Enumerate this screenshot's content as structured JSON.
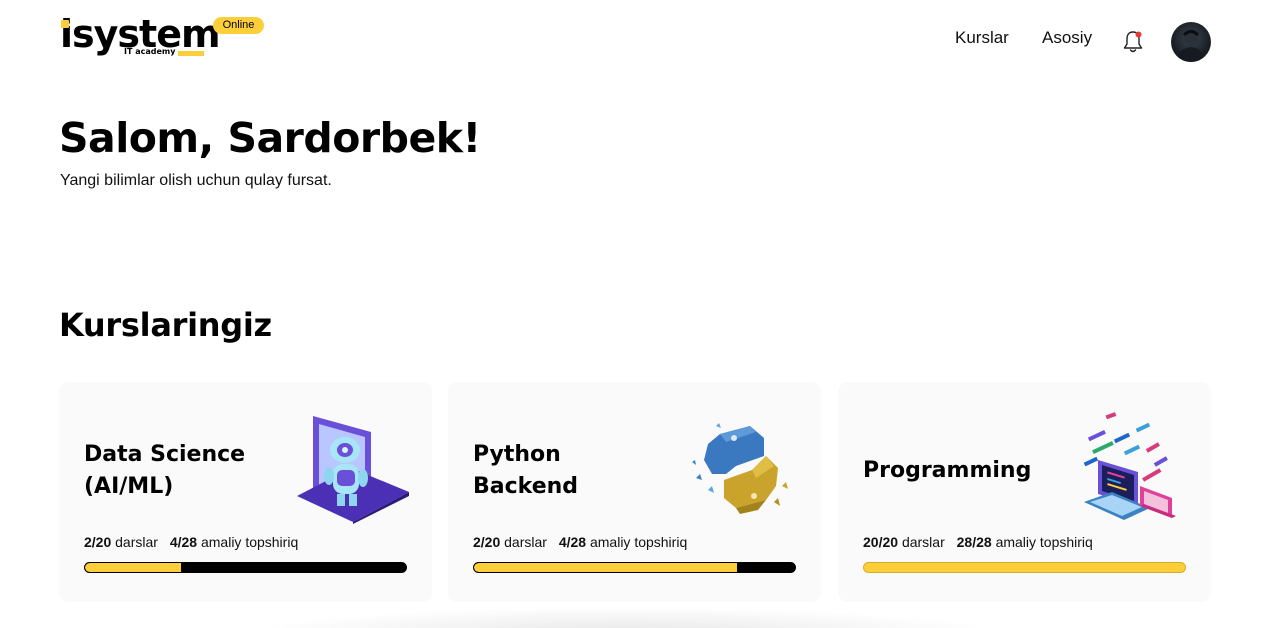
{
  "header": {
    "logo_text": "isystem",
    "logo_subtitle": "IT academy",
    "badge": "Online",
    "nav": [
      "Kurslar",
      "Asosiy"
    ],
    "icons": [
      "bell-icon",
      "avatar"
    ],
    "notification_dot_color": "#e53935"
  },
  "greeting": {
    "title": "Salom, Sardorbek!",
    "subtitle": "Yangi bilimlar olish uchun qulay fursat."
  },
  "courses_section": {
    "title": "Kurslaringiz",
    "courses": [
      {
        "title_lines": [
          "Data Science",
          "(AI/ML)"
        ],
        "lessons": "2/20",
        "lessons_label": "darslar",
        "tasks": "4/28",
        "tasks_label": "amaliy topshiriq",
        "progress": 0.3,
        "illustration": "robot-laptop-illustration"
      },
      {
        "title_lines": [
          "Python",
          "Backend"
        ],
        "lessons": "2/20",
        "lessons_label": "darslar",
        "tasks": "4/28",
        "tasks_label": "amaliy topshiriq",
        "progress": 0.82,
        "illustration": "python-logo-illustration"
      },
      {
        "title_lines": [
          "Programming"
        ],
        "lessons": "20/20",
        "lessons_label": "darslar",
        "tasks": "28/28",
        "tasks_label": "amaliy topshiriq",
        "progress": 1.0,
        "illustration": "code-computer-illustration"
      }
    ]
  },
  "colors": {
    "accent": "#fccf3a",
    "card_background": "#fafafa",
    "progress_track": "#000000"
  }
}
